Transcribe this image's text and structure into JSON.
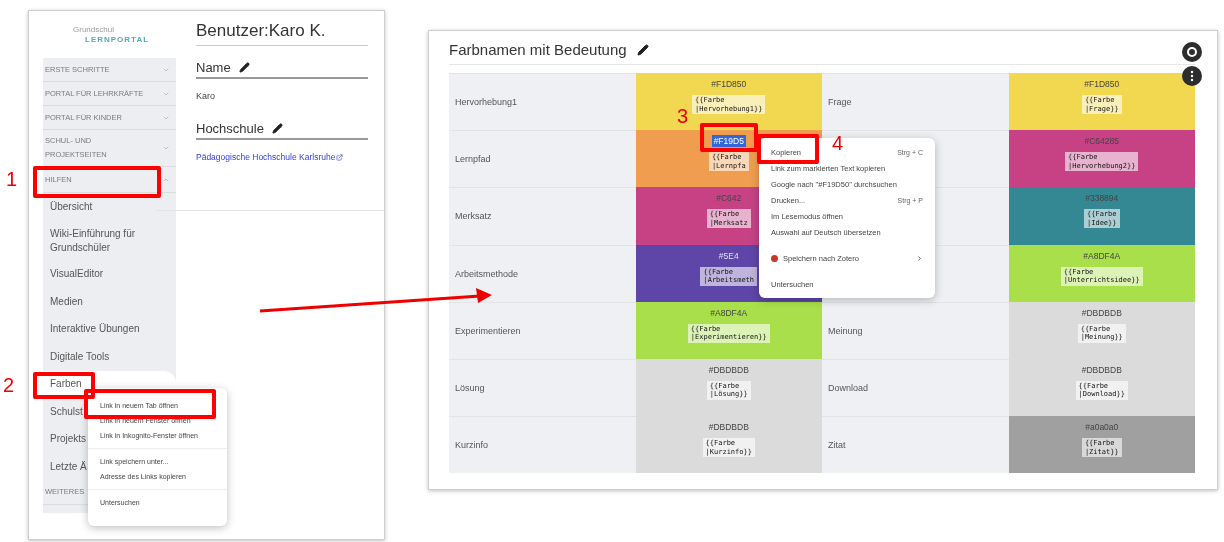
{
  "left_screen": {
    "logo": {
      "small": "Grundschul",
      "large": "LERNPORTAL"
    },
    "nav": [
      {
        "label": "ERSTE SCHRITTE",
        "expanded": false
      },
      {
        "label": "PORTAL FÜR LEHRKRÄFTE",
        "expanded": false
      },
      {
        "label": "PORTAL FÜR KINDER",
        "expanded": false
      },
      {
        "label": "SCHUL- UND PROJEKTSEITEN",
        "expanded": false
      },
      {
        "label": "HILFEN",
        "expanded": true,
        "children": [
          {
            "label": "Übersicht",
            "highlighted": false
          },
          {
            "label": "Wiki-Einführung für Grundschüler",
            "highlighted": false
          },
          {
            "label": "VisualEditor",
            "highlighted": false
          },
          {
            "label": "Medien",
            "highlighted": false
          },
          {
            "label": "Interaktive Übungen",
            "highlighted": false
          },
          {
            "label": "Digitale Tools",
            "highlighted": false
          },
          {
            "label": "Farben",
            "highlighted": true
          },
          {
            "label": "Schulst",
            "highlighted": false
          },
          {
            "label": "Projekts",
            "highlighted": false
          },
          {
            "label": "Letzte Ä",
            "highlighted": false
          }
        ]
      },
      {
        "label": "WEITERES",
        "expanded": false
      }
    ],
    "page_title": "Benutzer:Karo K.",
    "sections": [
      {
        "heading": "Name",
        "kind": "text",
        "value": "Karo"
      },
      {
        "heading": "Hochschule",
        "kind": "link",
        "value": "Pädagogische Hochschule Karlsruhe"
      }
    ],
    "context_menu": [
      {
        "kind": "item",
        "label": "Link in neuem Tab öffnen"
      },
      {
        "kind": "item",
        "label": "Link in neuem Fenster öffnen"
      },
      {
        "kind": "item",
        "label": "Link in Inkognito-Fenster öffnen"
      },
      {
        "kind": "separator"
      },
      {
        "kind": "item",
        "label": "Link speichern unter..."
      },
      {
        "kind": "item",
        "label": "Adresse des Links kopieren"
      },
      {
        "kind": "separator"
      },
      {
        "kind": "item",
        "label": "Untersuchen"
      }
    ]
  },
  "right_screen": {
    "title": "Farbnamen mit Bedeutung",
    "rows": [
      {
        "entries": [
          {
            "name": "Hervorhebung1",
            "hex": "#F1D850",
            "selected": false,
            "color": "#f1d850",
            "code_lines": [
              "{{Farbe",
              "|Hervorhebung1}}"
            ]
          },
          {
            "name": "Frage",
            "hex": "#F1D850",
            "selected": false,
            "color": "#f1d850",
            "code_lines": [
              "{{Farbe",
              "|Frage}}"
            ]
          }
        ]
      },
      {
        "entries": [
          {
            "name": "Lernpfad",
            "hex": "#F19D5",
            "selected": true,
            "color": "#f19d50",
            "code_lines": [
              "{{Farbe",
              "|Lernpfa"
            ]
          },
          {
            "hex": "#C64285",
            "selected": false,
            "color": "#c64285",
            "code_lines": [
              "{{Farbe",
              "|Hervorhebung2}}"
            ]
          }
        ]
      },
      {
        "entries": [
          {
            "name": "Merksatz",
            "hex": "#C642",
            "selected": false,
            "color": "#c64285",
            "code_lines": [
              "{{Farbe",
              "|Merksatz"
            ]
          },
          {
            "hex": "#338894",
            "selected": false,
            "color": "#338894",
            "code_lines": [
              "{{Farbe",
              "|Idee}}"
            ]
          }
        ]
      },
      {
        "entries": [
          {
            "name": "Arbeitsmethode",
            "hex": "#5E4",
            "selected": false,
            "color": "#5e45a8",
            "code_lines": [
              "{{Farbe",
              "|Arbeitsmeth"
            ]
          },
          {
            "hex": "#A8DF4A",
            "selected": false,
            "color": "#a8df4a",
            "code_lines": [
              "{{Farbe",
              "|Unterrichtsidee}}"
            ]
          }
        ]
      },
      {
        "entries": [
          {
            "name": "Experimentieren",
            "hex": "#A8DF4A",
            "selected": false,
            "color": "#a8df4a",
            "code_lines": [
              "{{Farbe",
              "|Experimentieren}}"
            ]
          },
          {
            "name": "Meinung",
            "hex": "#DBDBDB",
            "selected": false,
            "color": "#dbdbdb",
            "code_lines": [
              "{{Farbe",
              "|Meinung}}"
            ]
          }
        ]
      },
      {
        "entries": [
          {
            "name": "Lösung",
            "hex": "#DBDBDB",
            "selected": false,
            "color": "#dbdbdb",
            "code_lines": [
              "{{Farbe",
              "|Lösung}}"
            ]
          },
          {
            "name": "Download",
            "hex": "#DBDBDB",
            "selected": false,
            "color": "#dbdbdb",
            "code_lines": [
              "{{Farbe",
              "|Download}}"
            ]
          }
        ]
      },
      {
        "entries": [
          {
            "name": "Kurzinfo",
            "hex": "#DBDBDB",
            "selected": false,
            "color": "#dbdbdb",
            "code_lines": [
              "{{Farbe",
              "|Kurzinfo}}"
            ]
          },
          {
            "name": "Zitat",
            "hex": "#a0a0a0",
            "selected": false,
            "color": "#a0a0a0",
            "code_lines": [
              "{{Farbe",
              "|Zitat}}"
            ]
          }
        ]
      }
    ],
    "context_menu": [
      {
        "kind": "item",
        "label": "Kopieren",
        "shortcut": "Strg + C"
      },
      {
        "kind": "item",
        "label": "Link zum markierten Text kopieren"
      },
      {
        "kind": "item",
        "label": "Google nach \"#F19D50\" durchsuchen"
      },
      {
        "kind": "item",
        "label": "Drucken...",
        "shortcut": "Strg + P"
      },
      {
        "kind": "item",
        "label": "Im Lesemodus öffnen"
      },
      {
        "kind": "item",
        "label": "Auswahl auf Deutsch übersetzen"
      },
      {
        "kind": "separator"
      },
      {
        "kind": "submenu",
        "label": "Speichern nach Zotero"
      },
      {
        "kind": "separator"
      },
      {
        "kind": "item",
        "label": "Untersuchen"
      }
    ]
  },
  "annotations": [
    {
      "number": "1"
    },
    {
      "number": "2"
    },
    {
      "number": "3"
    },
    {
      "number": "4"
    }
  ]
}
